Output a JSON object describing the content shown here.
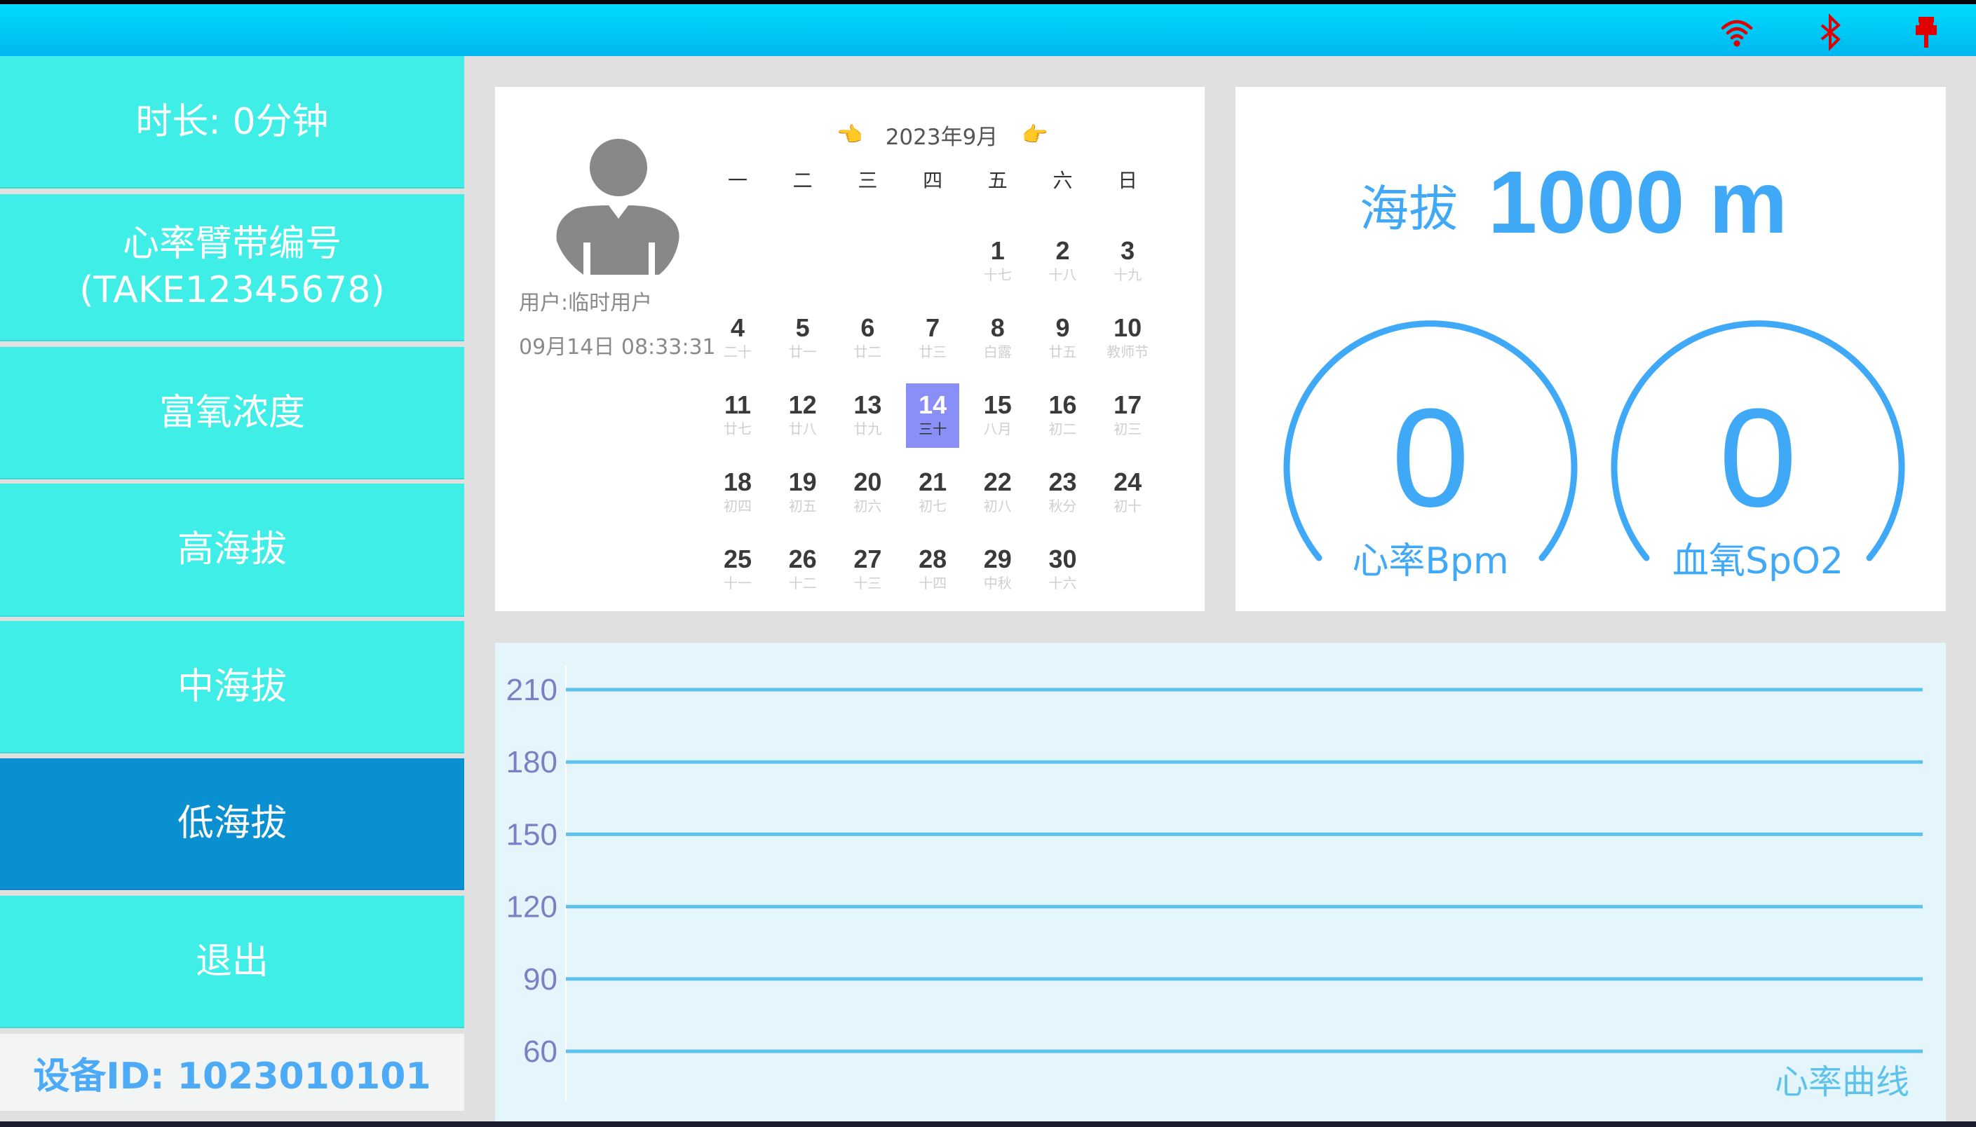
{
  "status_bar": {
    "icons": [
      {
        "name": "wifi-icon",
        "state": "disconnected",
        "color": "#e00000"
      },
      {
        "name": "bluetooth-icon",
        "state": "disconnected",
        "color": "#e00000"
      },
      {
        "name": "serial-port-icon",
        "state": "disconnected",
        "color": "#e00000"
      }
    ]
  },
  "sidebar": {
    "items": [
      {
        "label": "时长: 0分钟",
        "active": false
      },
      {
        "label": "心率臂带编号\n(TAKE12345678)",
        "active": false
      },
      {
        "label": "富氧浓度",
        "active": false
      },
      {
        "label": "高海拔",
        "active": false
      },
      {
        "label": "中海拔",
        "active": false
      },
      {
        "label": "低海拔",
        "active": true
      },
      {
        "label": "退出",
        "active": false
      }
    ],
    "device_id": "设备ID: 1023010101"
  },
  "user_panel": {
    "user_label": "用户:临时用户",
    "datetime": "09月14日 08:33:31"
  },
  "calendar": {
    "title": "2023年9月",
    "prev_icon": "👈",
    "next_icon": "👉",
    "weekdays": [
      "一",
      "二",
      "三",
      "四",
      "五",
      "六",
      "日"
    ],
    "first_weekday_index": 4,
    "selected_day": 14,
    "days": [
      {
        "d": "1",
        "l": "十七"
      },
      {
        "d": "2",
        "l": "十八"
      },
      {
        "d": "3",
        "l": "十九"
      },
      {
        "d": "4",
        "l": "二十"
      },
      {
        "d": "5",
        "l": "廿一"
      },
      {
        "d": "6",
        "l": "廿二"
      },
      {
        "d": "7",
        "l": "廿三"
      },
      {
        "d": "8",
        "l": "白露"
      },
      {
        "d": "9",
        "l": "廿五"
      },
      {
        "d": "10",
        "l": "教师节"
      },
      {
        "d": "11",
        "l": "廿七"
      },
      {
        "d": "12",
        "l": "廿八"
      },
      {
        "d": "13",
        "l": "廿九"
      },
      {
        "d": "14",
        "l": "三十"
      },
      {
        "d": "15",
        "l": "八月"
      },
      {
        "d": "16",
        "l": "初二"
      },
      {
        "d": "17",
        "l": "初三"
      },
      {
        "d": "18",
        "l": "初四"
      },
      {
        "d": "19",
        "l": "初五"
      },
      {
        "d": "20",
        "l": "初六"
      },
      {
        "d": "21",
        "l": "初七"
      },
      {
        "d": "22",
        "l": "初八"
      },
      {
        "d": "23",
        "l": "秋分"
      },
      {
        "d": "24",
        "l": "初十"
      },
      {
        "d": "25",
        "l": "十一"
      },
      {
        "d": "26",
        "l": "十二"
      },
      {
        "d": "27",
        "l": "十三"
      },
      {
        "d": "28",
        "l": "十四"
      },
      {
        "d": "29",
        "l": "中秋"
      },
      {
        "d": "30",
        "l": "十六"
      }
    ],
    "highlight_color": "#8a8ff7"
  },
  "vitals": {
    "altitude_label": "海拔",
    "altitude_value": "1000 m",
    "heart_rate": {
      "value": "0",
      "label": "心率Bpm"
    },
    "spo2": {
      "value": "0",
      "label": "血氧SpO2"
    },
    "accent_color": "#40a9f7"
  },
  "chart_data": {
    "type": "line",
    "title": "心率曲线",
    "xlabel": "",
    "ylabel": "",
    "y_ticks": [
      210,
      180,
      150,
      120,
      90,
      60
    ],
    "ylim": [
      60,
      210
    ],
    "grid": true,
    "series": [
      {
        "name": "心率",
        "values": []
      }
    ]
  },
  "colors": {
    "sidebar_item": "#40eee8",
    "sidebar_active": "#0a8fd0",
    "topbar": "#00c6f5",
    "chart_bg": "#e4f5fc",
    "gridline": "#5ec3ec",
    "tick_label": "#7b7fc4"
  }
}
